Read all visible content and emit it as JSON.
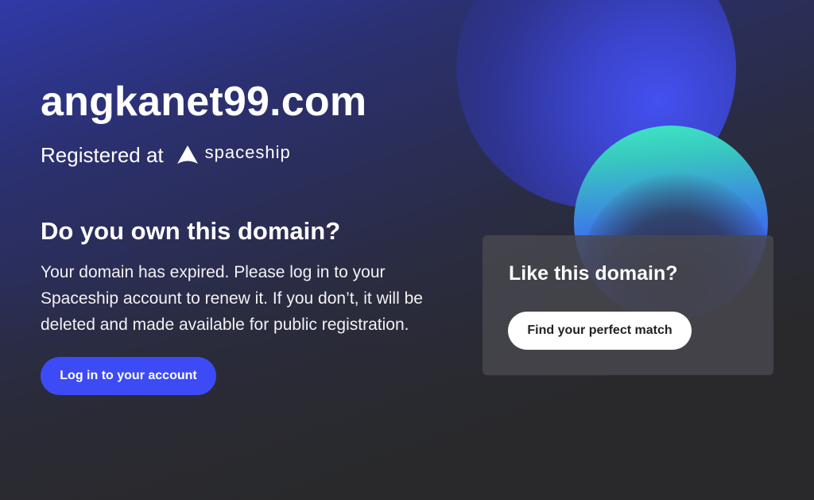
{
  "page": {
    "domain": "angkanet99.com",
    "registered_at_label": "Registered at",
    "registrar_name": "spaceship",
    "registrar_logo_icon": "spaceship-logo-icon"
  },
  "ownership": {
    "heading": "Do you own this domain?",
    "body": "Your domain has expired. Please log in to your Spaceship account to renew it. If you don’t, it will be deleted and made available for public registration.",
    "login_button": "Log in to your account"
  },
  "promo": {
    "heading": "Like this domain?",
    "button": "Find your perfect match"
  },
  "colors": {
    "accent": "#3c4bf5",
    "orb_teal": "#3ee8c4",
    "orb_blue": "#4250f0",
    "background_dark": "#29292b",
    "card": "#48484e"
  }
}
